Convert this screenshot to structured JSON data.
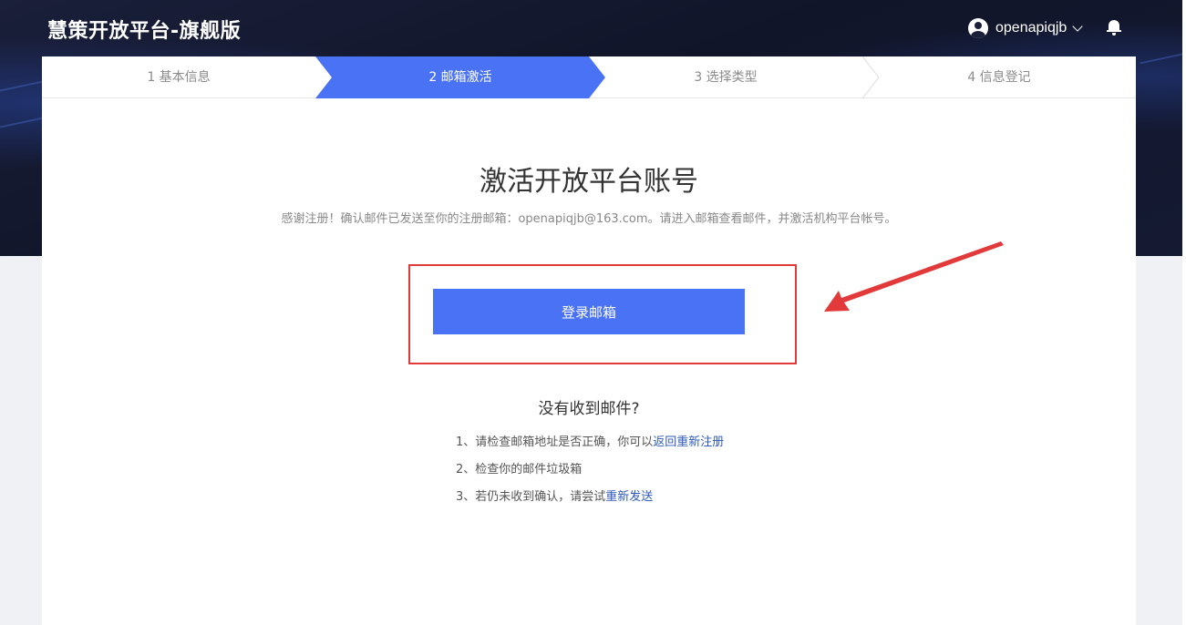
{
  "header": {
    "brand": "慧策开放平台-旗舰版",
    "username": "openapiqjb"
  },
  "steps": [
    {
      "label": "1 基本信息",
      "active": false
    },
    {
      "label": "2 邮箱激活",
      "active": true
    },
    {
      "label": "3 选择类型",
      "active": false
    },
    {
      "label": "4 信息登记",
      "active": false
    }
  ],
  "main": {
    "title": "激活开放平台账号",
    "subtitle": "感谢注册！确认邮件已发送至你的注册邮箱：openapiqjb@163.com。请进入邮箱查看邮件，并激活机构平台帐号。",
    "login_button": "登录邮箱",
    "no_mail_title": "没有收到邮件?",
    "tips": {
      "tip1_text": "1、请检查邮箱地址是否正确，你可以",
      "tip1_link": "返回重新注册",
      "tip2_text": "2、检查你的邮件垃圾箱",
      "tip3_text": "3、若仍未收到确认，请尝试",
      "tip3_link": "重新发送"
    }
  },
  "colors": {
    "accent": "#4a72f5",
    "highlight": "#e23a3a",
    "link": "#2d5ab8",
    "header_bg": "#151a33"
  },
  "icons": [
    "user-avatar-icon",
    "chevron-down-icon",
    "bell-icon",
    "red-arrow-annotation"
  ]
}
